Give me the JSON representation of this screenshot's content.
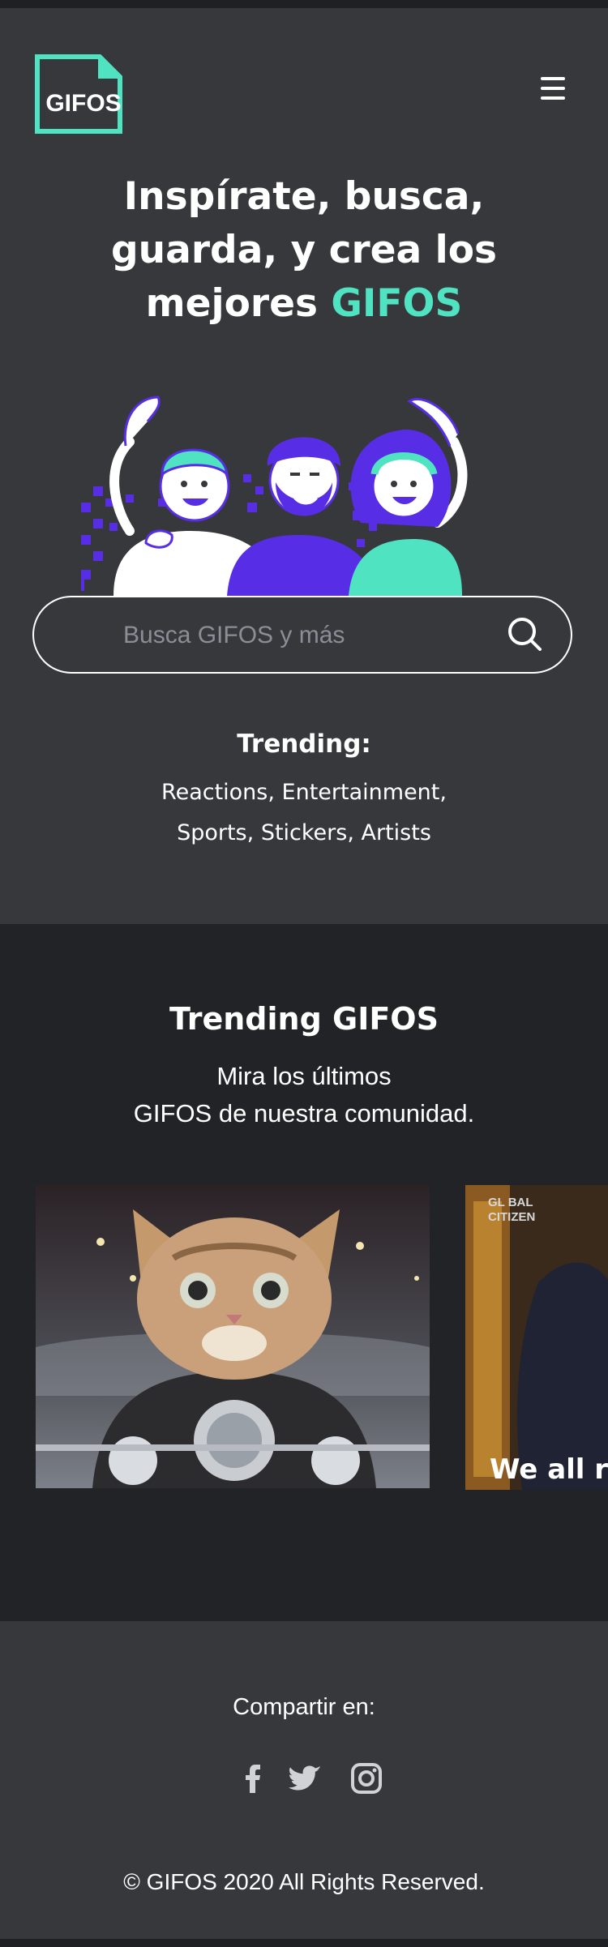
{
  "header": {
    "logo_text": "GIFOS"
  },
  "hero": {
    "title_line1": "Inspírate, busca,",
    "title_line2": "guarda, y crea los",
    "title_line3_prefix": "mejores ",
    "title_line3_accent": "GIFOS"
  },
  "search": {
    "placeholder": "Busca GIFOS y más"
  },
  "trending": {
    "label": "Trending:",
    "topics": [
      "Reactions",
      "Entertainment",
      "Sports",
      "Stickers",
      "Artists"
    ]
  },
  "trending_gifos": {
    "title": "Trending GIFOS",
    "subtitle_line1": "Mira los últimos",
    "subtitle_line2": "GIFOS de nuestra comunidad.",
    "gif2_watermark_line1": "GL BAL",
    "gif2_watermark_line2": "CITIZEN",
    "gif2_caption": "We all r"
  },
  "footer": {
    "share_label": "Compartir en:",
    "copyright": "© GIFOS 2020 All Rights Reserved."
  },
  "colors": {
    "accent": "#50e3c2",
    "purple": "#572ee5",
    "background": "#37383c",
    "section_dark": "#222326"
  },
  "icons": [
    "gifos-logo-icon",
    "menu-icon",
    "search-icon",
    "facebook-icon",
    "twitter-icon",
    "instagram-icon"
  ]
}
